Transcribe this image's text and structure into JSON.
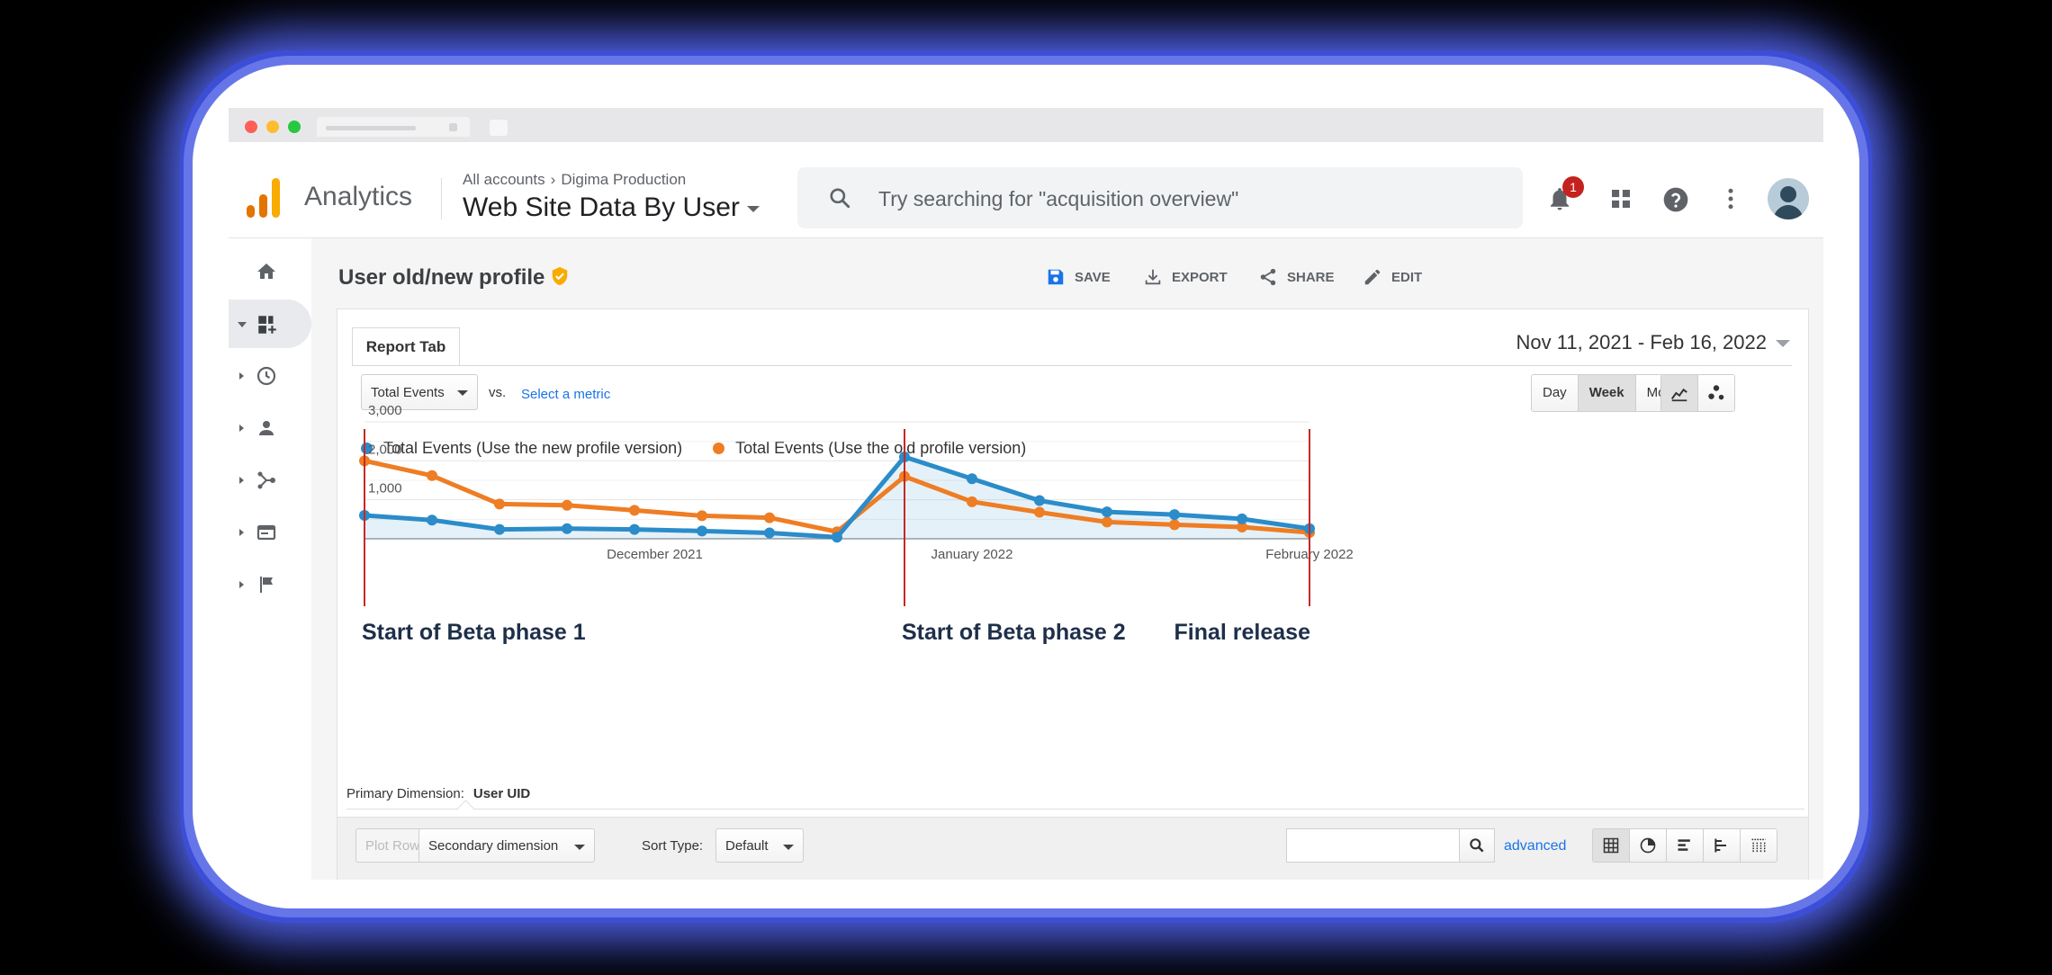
{
  "header": {
    "app_name": "Analytics",
    "breadcrumb": {
      "account": "All accounts",
      "property": "Digima Production"
    },
    "view_name": "Web Site Data By User",
    "search_placeholder": "Try searching for \"acquisition overview\"",
    "notification_count": "1"
  },
  "sidebar": {
    "items": [
      {
        "icon": "home-icon"
      },
      {
        "icon": "dashboard-icon",
        "active": true
      },
      {
        "icon": "clock-icon"
      },
      {
        "icon": "person-icon"
      },
      {
        "icon": "acquisition-icon"
      },
      {
        "icon": "behavior-icon"
      },
      {
        "icon": "flag-icon"
      }
    ]
  },
  "report": {
    "title": "User old/new profile",
    "actions": {
      "save": "SAVE",
      "export": "EXPORT",
      "share": "SHARE",
      "edit": "EDIT"
    },
    "tab_label": "Report Tab",
    "date_range": "Nov 11, 2021 - Feb 16, 2022",
    "metric_select": "Total Events",
    "vs_label": "vs.",
    "select_metric": "Select a metric",
    "period_buttons": {
      "day": "Day",
      "week": "Week",
      "month": "Month",
      "active": "Week"
    }
  },
  "chart_data": {
    "type": "line",
    "series": [
      {
        "name": "Total Events (Use the new profile version)",
        "color": "#2b8cc9",
        "values": [
          600,
          480,
          240,
          260,
          240,
          200,
          150,
          40,
          2100,
          1540,
          980,
          690,
          620,
          510,
          260
        ]
      },
      {
        "name": "Total Events (Use the old profile version)",
        "color": "#ee7d24",
        "values": [
          2000,
          1620,
          890,
          860,
          730,
          590,
          540,
          180,
          1600,
          950,
          680,
          430,
          360,
          300,
          160
        ]
      }
    ],
    "y_ticks": [
      "3,000",
      "2,000",
      "1,000"
    ],
    "ylim": [
      0,
      3000
    ],
    "x_labels": [
      {
        "label": "December 2021",
        "at": 4.3
      },
      {
        "label": "January 2022",
        "at": 9.0
      },
      {
        "label": "February 2022",
        "at": 14.0
      }
    ],
    "grid": true,
    "markers": [
      {
        "label": "Start of Beta phase 1",
        "index": 0,
        "align": "left"
      },
      {
        "label": "Start of Beta phase 2",
        "index": 8,
        "align": "left"
      },
      {
        "label": "Final release",
        "index": 14,
        "align": "right"
      }
    ]
  },
  "table_controls": {
    "primary_dimension_label": "Primary Dimension:",
    "primary_dimension_value": "User UID",
    "plot_rows": "Plot Rows",
    "secondary_dimension": "Secondary dimension",
    "sort_type_label": "Sort Type:",
    "sort_type_value": "Default",
    "advanced": "advanced"
  }
}
